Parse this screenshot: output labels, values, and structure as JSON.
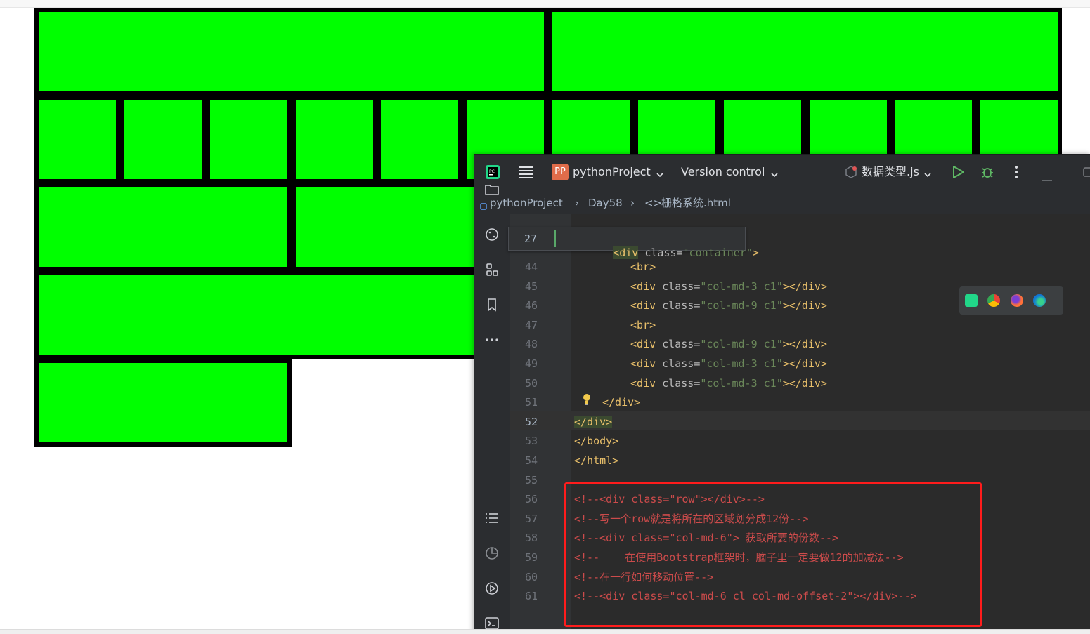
{
  "colors": {
    "grid_fill": "#00ff00",
    "grid_border": "#000000",
    "ide_background": "#2b2d30",
    "editor_background": "#2b2b2b",
    "highlight_box": "#ff1c1c"
  },
  "grid": {
    "rows": [
      {
        "columns": 2,
        "span_each": 6
      },
      {
        "columns": 12,
        "span_each": 1
      },
      {
        "columns": 4,
        "span_each": 3
      },
      {
        "columns": 1,
        "span_each": 12
      },
      {
        "columns": 1,
        "span_each": 3
      }
    ]
  },
  "ide": {
    "app_icon": "pycharm-logo-icon",
    "project_badge": "PP",
    "project_name": "pythonProject",
    "vcs_label": "Version control",
    "run_config": "数据类型.js",
    "breadcrumbs": [
      "pythonProject",
      "Day58",
      "栅格系统.html"
    ],
    "sticky_line": {
      "number": "27",
      "code": {
        "open": "<div",
        "attr": "class",
        "eq": "=",
        "value": "\"container\"",
        "close": ">"
      }
    },
    "lines": [
      {
        "n": "44",
        "code": {
          "tag": "<br>"
        }
      },
      {
        "n": "45",
        "code": {
          "open": "<div",
          "attr": "class",
          "eq": "=",
          "value": "\"col-md-3 c1\"",
          "close": "></div>"
        }
      },
      {
        "n": "46",
        "code": {
          "open": "<div",
          "attr": "class",
          "eq": "=",
          "value": "\"col-md-9 c1\"",
          "close": "></div>"
        }
      },
      {
        "n": "47",
        "code": {
          "tag": "<br>"
        }
      },
      {
        "n": "48",
        "code": {
          "open": "<div",
          "attr": "class",
          "eq": "=",
          "value": "\"col-md-9 c1\"",
          "close": "></div>"
        }
      },
      {
        "n": "49",
        "code": {
          "open": "<div",
          "attr": "class",
          "eq": "=",
          "value": "\"col-md-3 c1\"",
          "close": "></div>"
        }
      },
      {
        "n": "50",
        "code": {
          "open": "<div",
          "attr": "class",
          "eq": "=",
          "value": "\"col-md-3 c1\"",
          "close": "></div>"
        }
      },
      {
        "n": "51",
        "code": {
          "tag": "</div>"
        }
      },
      {
        "n": "52",
        "code": {
          "tag": "</div>"
        }
      },
      {
        "n": "53",
        "code": {
          "tag": "</body>"
        }
      },
      {
        "n": "54",
        "code": {
          "tag": "</html>"
        }
      },
      {
        "n": "55",
        "code": {
          "tag": ""
        }
      },
      {
        "n": "56",
        "comment": "<!--<div class=\"row\"></div>-->"
      },
      {
        "n": "57",
        "comment": "<!--写一个row就是将所在的区域划分成12份-->"
      },
      {
        "n": "58",
        "comment": "<!--<div class=\"col-md-6\"> 获取所要的份数-->"
      },
      {
        "n": "59",
        "comment": "<!--    在使用Bootstrap框架时，脑子里一定要做12的加减法-->"
      },
      {
        "n": "60",
        "comment": "<!--在一行如何移动位置-->"
      },
      {
        "n": "61",
        "comment": "<!--<div class=\"col-md-6 cl col-md-offset-2\"></div>-->"
      }
    ],
    "toolbar_icons": [
      "folder-icon",
      "python-packages-icon",
      "structure-icon",
      "bookmarks-icon",
      "more-icon",
      "todo-icon",
      "profiler-icon",
      "services-icon",
      "terminal-icon"
    ],
    "browser_icons": [
      "pycharm-browser-icon",
      "chrome-icon",
      "firefox-icon",
      "edge-icon"
    ]
  }
}
